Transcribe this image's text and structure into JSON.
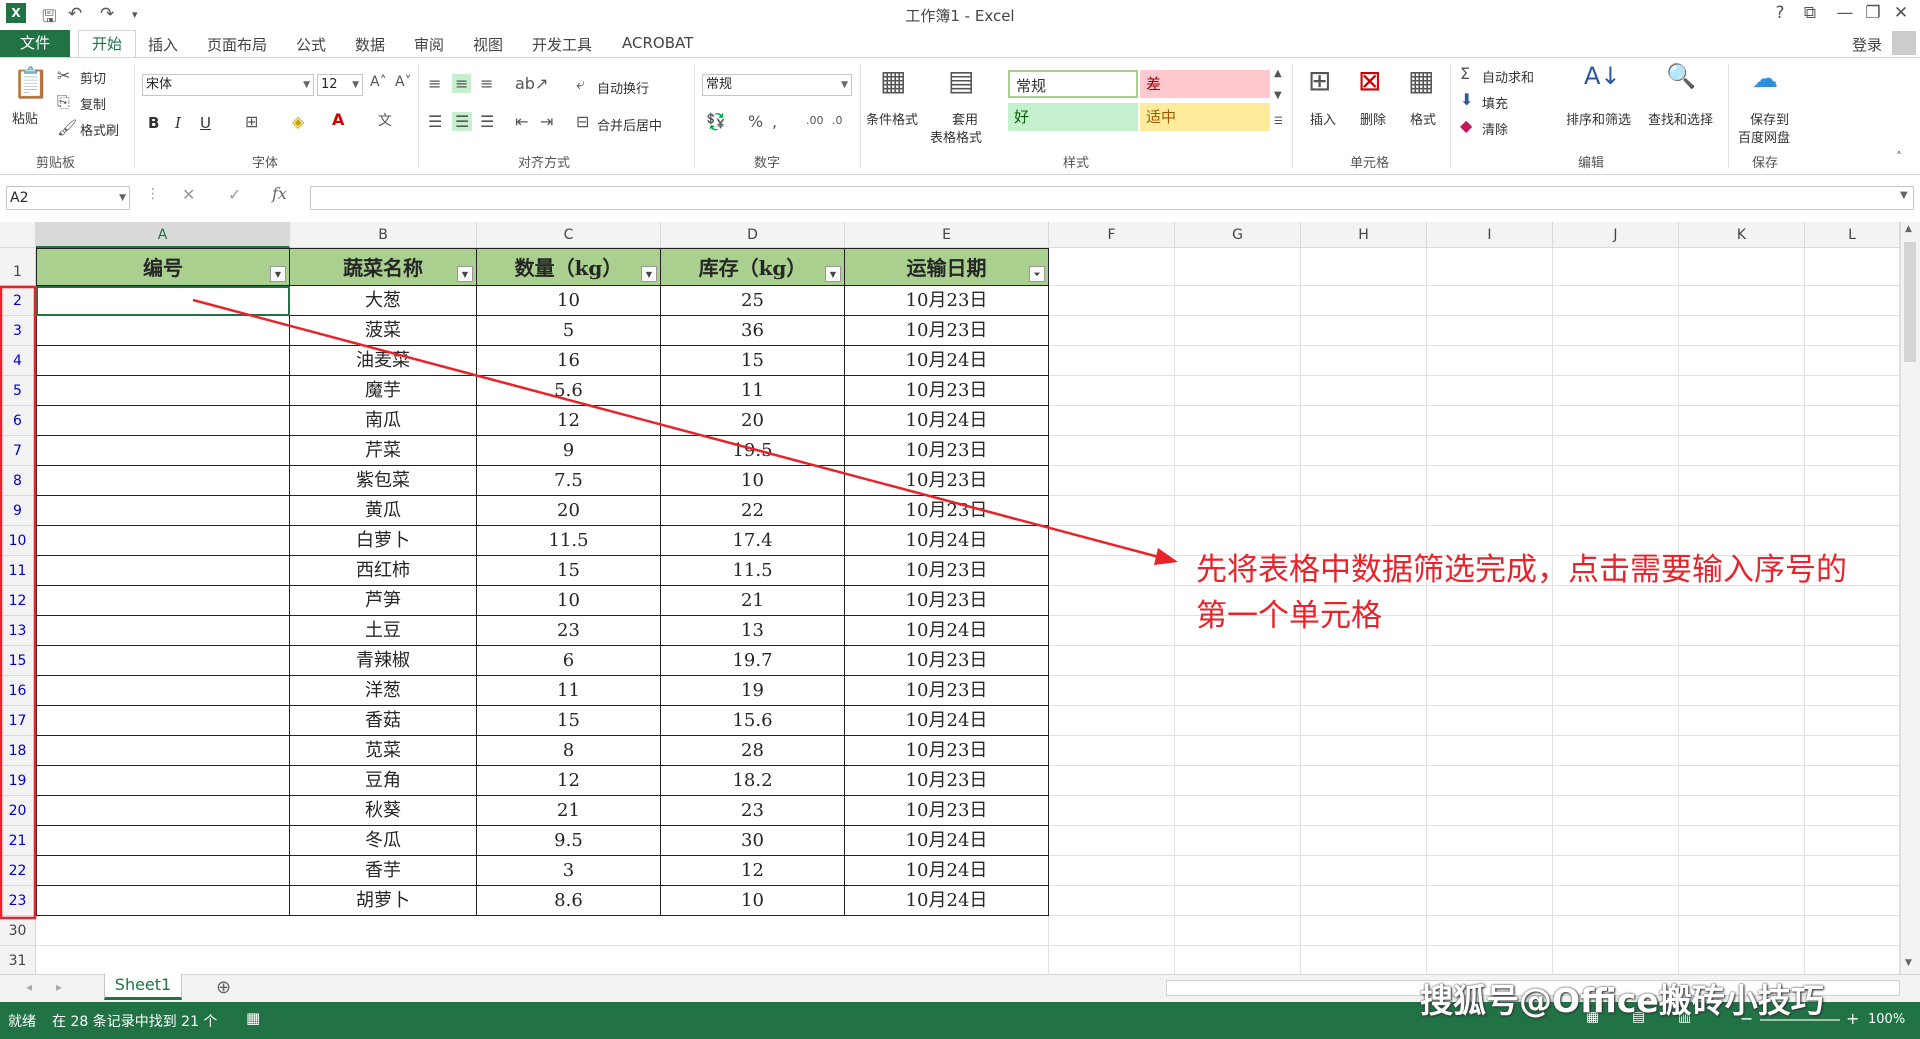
{
  "window": {
    "title": "工作簿1 - Excel",
    "controls": [
      "?",
      "⧉",
      "—",
      "❐",
      "✕"
    ]
  },
  "menu": {
    "file": "文件",
    "home": "开始",
    "items": [
      "插入",
      "页面布局",
      "公式",
      "数据",
      "审阅",
      "视图",
      "开发工具",
      "ACROBAT"
    ],
    "login": "登录"
  },
  "ribbon": {
    "clipboard": {
      "paste": "粘贴",
      "cut": "剪切",
      "copy": "复制",
      "format_painter": "格式刷",
      "label": "剪贴板"
    },
    "font": {
      "name": "宋体",
      "size": "12",
      "bold": "B",
      "italic": "I",
      "underline": "U",
      "label": "字体"
    },
    "alignment": {
      "wrap": "自动换行",
      "merge": "合并后居中",
      "label": "对齐方式"
    },
    "number": {
      "format": "常规",
      "label": "数字"
    },
    "styles": {
      "conditional": "条件格式",
      "table_format_1": "套用",
      "table_format_2": "表格格式",
      "normal": "常规",
      "bad": "差",
      "good": "好",
      "neutral": "适中",
      "label": "样式"
    },
    "cells": {
      "insert": "插入",
      "delete": "删除",
      "format": "格式",
      "label": "单元格"
    },
    "editing": {
      "autosum": "自动求和",
      "fill": "填充",
      "clear": "清除",
      "sort": "排序和筛选",
      "find": "查找和选择",
      "label": "编辑"
    },
    "save": {
      "save_1": "保存到",
      "save_2": "百度网盘",
      "label": "保存"
    }
  },
  "formula_bar": {
    "name_box": "A2",
    "value": ""
  },
  "columns": [
    "A",
    "B",
    "C",
    "D",
    "E",
    "F",
    "G",
    "H",
    "I",
    "J",
    "K",
    "L"
  ],
  "table": {
    "headers": [
      "编号",
      "蔬菜名称",
      "数量（kg）",
      "库存（kg）",
      "运输日期"
    ],
    "rows": [
      {
        "row": "2",
        "name": "大葱",
        "qty": "10",
        "stock": "25",
        "date": "10月23日"
      },
      {
        "row": "3",
        "name": "菠菜",
        "qty": "5",
        "stock": "36",
        "date": "10月23日"
      },
      {
        "row": "4",
        "name": "油麦菜",
        "qty": "16",
        "stock": "15",
        "date": "10月24日"
      },
      {
        "row": "5",
        "name": "魔芋",
        "qty": "5.6",
        "stock": "11",
        "date": "10月23日"
      },
      {
        "row": "6",
        "name": "南瓜",
        "qty": "12",
        "stock": "20",
        "date": "10月24日"
      },
      {
        "row": "7",
        "name": "芹菜",
        "qty": "9",
        "stock": "19.5",
        "date": "10月23日"
      },
      {
        "row": "8",
        "name": "紫包菜",
        "qty": "7.5",
        "stock": "10",
        "date": "10月23日"
      },
      {
        "row": "9",
        "name": "黄瓜",
        "qty": "20",
        "stock": "22",
        "date": "10月23日"
      },
      {
        "row": "10",
        "name": "白萝卜",
        "qty": "11.5",
        "stock": "17.4",
        "date": "10月24日"
      },
      {
        "row": "11",
        "name": "西红柿",
        "qty": "15",
        "stock": "11.5",
        "date": "10月23日"
      },
      {
        "row": "12",
        "name": "芦笋",
        "qty": "10",
        "stock": "21",
        "date": "10月23日"
      },
      {
        "row": "13",
        "name": "土豆",
        "qty": "23",
        "stock": "13",
        "date": "10月24日"
      },
      {
        "row": "15",
        "name": "青辣椒",
        "qty": "6",
        "stock": "19.7",
        "date": "10月23日"
      },
      {
        "row": "16",
        "name": "洋葱",
        "qty": "11",
        "stock": "19",
        "date": "10月23日"
      },
      {
        "row": "17",
        "name": "香菇",
        "qty": "15",
        "stock": "15.6",
        "date": "10月24日"
      },
      {
        "row": "18",
        "name": "苋菜",
        "qty": "8",
        "stock": "28",
        "date": "10月23日"
      },
      {
        "row": "19",
        "name": "豆角",
        "qty": "12",
        "stock": "18.2",
        "date": "10月23日"
      },
      {
        "row": "20",
        "name": "秋葵",
        "qty": "21",
        "stock": "23",
        "date": "10月23日"
      },
      {
        "row": "21",
        "name": "冬瓜",
        "qty": "9.5",
        "stock": "30",
        "date": "10月24日"
      },
      {
        "row": "22",
        "name": "香芋",
        "qty": "3",
        "stock": "12",
        "date": "10月24日"
      },
      {
        "row": "23",
        "name": "胡萝卜",
        "qty": "8.6",
        "stock": "10",
        "date": "10月24日"
      }
    ],
    "extra_rows": [
      "30",
      "31"
    ]
  },
  "annotation": {
    "line1": "先将表格中数据筛选完成，点击需要输入序号的",
    "line2": "第一个单元格"
  },
  "sheet_tab": "Sheet1",
  "status": {
    "mode": "就绪",
    "filter_info": "在 28 条记录中找到 21 个",
    "zoom": "100%"
  },
  "watermark": "搜狐号@Office搬砖小技巧",
  "colors": {
    "excel_green": "#217346",
    "header_fill": "#a9d08e",
    "annotation_red": "#e8232a"
  }
}
